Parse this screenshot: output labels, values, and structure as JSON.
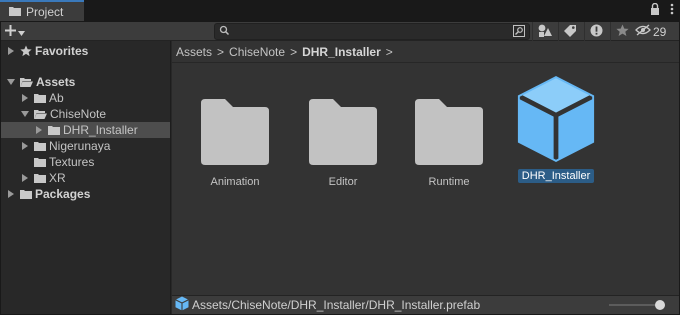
{
  "window": {
    "tab_label": "Project",
    "icons": [
      "folder-icon",
      "lock-icon",
      "more-icon"
    ]
  },
  "toolbar": {
    "create_label": "+",
    "search_value": "",
    "hidden_count": "29",
    "buttons": [
      "search-by-type-icon",
      "search-by-label-icon",
      "error-filter-icon",
      "favorite-icon"
    ]
  },
  "sidebar": {
    "items": [
      {
        "label": "Favorites",
        "expanded": false,
        "depth": 0,
        "icon": "star-icon",
        "bold": true,
        "selected": false
      },
      {
        "label": "Assets",
        "expanded": true,
        "depth": 0,
        "icon": "folder-open-icon",
        "bold": true,
        "selected": false
      },
      {
        "label": "Ab",
        "expanded": false,
        "depth": 1,
        "icon": "folder-icon",
        "bold": false,
        "selected": false
      },
      {
        "label": "ChiseNote",
        "expanded": true,
        "depth": 1,
        "icon": "folder-open-icon",
        "bold": false,
        "selected": false
      },
      {
        "label": "DHR_Installer",
        "expanded": false,
        "depth": 2,
        "icon": "folder-icon",
        "bold": false,
        "selected": true
      },
      {
        "label": "Nigerunaya",
        "expanded": false,
        "depth": 1,
        "icon": "folder-icon",
        "bold": false,
        "selected": false
      },
      {
        "label": "Textures",
        "expanded": null,
        "depth": 1,
        "icon": "folder-icon",
        "bold": false,
        "selected": false
      },
      {
        "label": "XR",
        "expanded": false,
        "depth": 1,
        "icon": "folder-icon",
        "bold": false,
        "selected": false
      },
      {
        "label": "Packages",
        "expanded": false,
        "depth": 0,
        "icon": "folder-icon",
        "bold": true,
        "selected": false
      }
    ]
  },
  "breadcrumb": {
    "items": [
      "Assets",
      "ChiseNote",
      "DHR_Installer"
    ],
    "separator": ">"
  },
  "grid": {
    "items": [
      {
        "label": "Animation",
        "icon": "folder-icon",
        "selected": false
      },
      {
        "label": "Editor",
        "icon": "folder-icon",
        "selected": false
      },
      {
        "label": "Runtime",
        "icon": "folder-icon",
        "selected": false
      },
      {
        "label": "DHR_Installer",
        "icon": "prefab-icon",
        "selected": true
      }
    ]
  },
  "status": {
    "path": "Assets/ChiseNote/DHR_Installer/DHR_Installer.prefab",
    "icon": "prefab-icon",
    "zoom_fraction": 1.0
  },
  "colors": {
    "accent": "#3a79bb",
    "selection": "#2c5d87",
    "folder": "#c2c2c2",
    "prefab": "#66b8f5"
  }
}
